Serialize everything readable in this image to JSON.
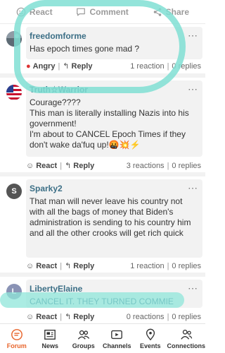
{
  "top_actions": {
    "react": "React",
    "comment": "Comment",
    "share": "Share"
  },
  "comments": [
    {
      "user": "freedomforme",
      "text": "Has epoch times gone mad ?",
      "reaction_label": "Angry",
      "reply_label": "Reply",
      "reactions": "1 reaction",
      "replies": "0 replies",
      "avatar_letter": ""
    },
    {
      "user": "Truth☆Warrior",
      "text_lines": [
        "Courage????",
        "This man is literally installing Nazis into his government!",
        "I'm about to CANCEL Epoch Times if they don't wake da'fuq up!🤬💥⚡"
      ],
      "reaction_label": "React",
      "reply_label": "Reply",
      "reactions": "3 reactions",
      "replies": "0 replies"
    },
    {
      "user": "Sparky2",
      "text": "That man will never leave his country not with all the bags of money that Biden's administration is sending to his country him and all the other crooks will get rich quick",
      "reaction_label": "React",
      "reply_label": "Reply",
      "reactions": "1 reaction",
      "replies": "0 replies",
      "avatar_letter": "S"
    },
    {
      "user": "LibertyElaine",
      "text": "CANCEL IT. THEY TURNED COMMIE",
      "reaction_label": "React",
      "reply_label": "Reply",
      "reactions": "0 reactions",
      "replies": "0 replies",
      "avatar_letter": "L"
    }
  ],
  "more_label": "⋯",
  "separator": "|",
  "nav": [
    {
      "label": "Forum",
      "icon": "forum-icon",
      "active": true
    },
    {
      "label": "News",
      "icon": "news-icon"
    },
    {
      "label": "Groups",
      "icon": "groups-icon"
    },
    {
      "label": "Channels",
      "icon": "channels-icon"
    },
    {
      "label": "Events",
      "icon": "events-icon"
    },
    {
      "label": "Connections",
      "icon": "connections-icon"
    }
  ],
  "colors": {
    "accent": "#e8642b",
    "username": "#3c6f86",
    "highlight": "#80dfd3"
  }
}
